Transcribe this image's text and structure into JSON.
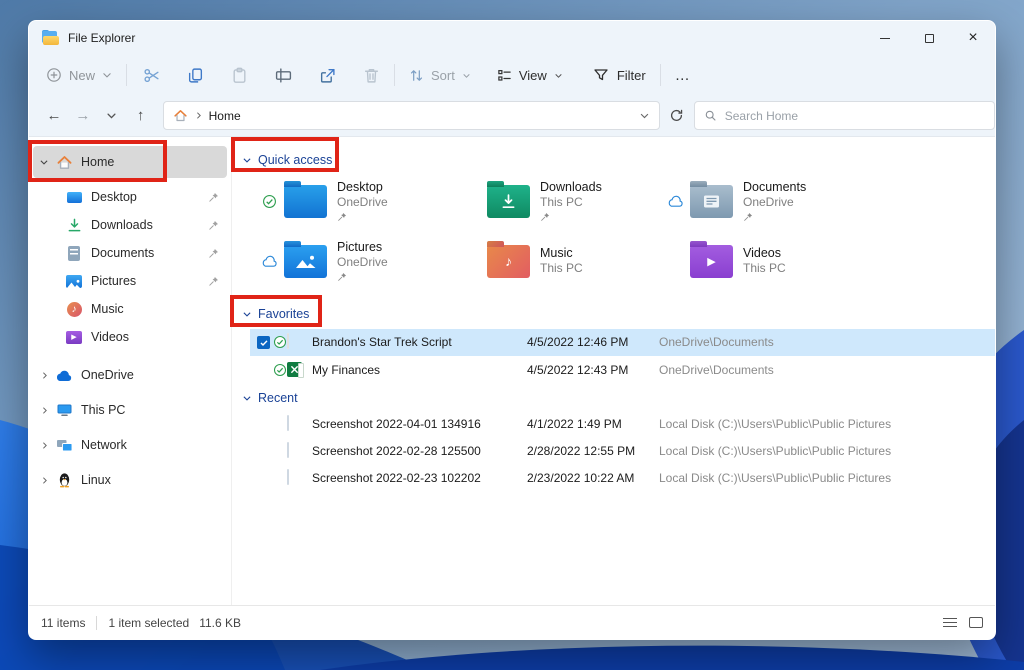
{
  "window": {
    "title": "File Explorer"
  },
  "toolbar": {
    "new": "New",
    "sort": "Sort",
    "view": "View",
    "filter": "Filter",
    "more": "…"
  },
  "address_bar": {
    "location": "Home",
    "search_placeholder": "Search Home"
  },
  "sidebar": {
    "items": [
      {
        "label": "Home"
      },
      {
        "label": "Desktop"
      },
      {
        "label": "Downloads"
      },
      {
        "label": "Documents"
      },
      {
        "label": "Pictures"
      },
      {
        "label": "Music"
      },
      {
        "label": "Videos"
      },
      {
        "label": "OneDrive"
      },
      {
        "label": "This PC"
      },
      {
        "label": "Network"
      },
      {
        "label": "Linux"
      }
    ]
  },
  "quick_access": {
    "header": "Quick access",
    "tiles": [
      {
        "name": "Desktop",
        "location": "OneDrive",
        "pinned": true,
        "sync": "synced"
      },
      {
        "name": "Downloads",
        "location": "This PC",
        "pinned": true,
        "sync": "none"
      },
      {
        "name": "Documents",
        "location": "OneDrive",
        "pinned": true,
        "sync": "cloud"
      },
      {
        "name": "Pictures",
        "location": "OneDrive",
        "pinned": true,
        "sync": "cloud"
      },
      {
        "name": "Music",
        "location": "This PC",
        "pinned": false,
        "sync": "none"
      },
      {
        "name": "Videos",
        "location": "This PC",
        "pinned": false,
        "sync": "none"
      }
    ]
  },
  "favorites": {
    "header": "Favorites",
    "files": [
      {
        "name": "Brandon's Star Trek Script",
        "date": "4/5/2022 12:46 PM",
        "location": "OneDrive\\Documents",
        "selected": true
      },
      {
        "name": "My Finances",
        "date": "4/5/2022 12:43 PM",
        "location": "OneDrive\\Documents",
        "selected": false
      }
    ]
  },
  "recent": {
    "header": "Recent",
    "files": [
      {
        "name": "Screenshot 2022-04-01 134916",
        "date": "4/1/2022 1:49 PM",
        "location": "Local Disk (C:)\\Users\\Public\\Public Pictures"
      },
      {
        "name": "Screenshot 2022-02-28 125500",
        "date": "2/28/2022 12:55 PM",
        "location": "Local Disk (C:)\\Users\\Public\\Public Pictures"
      },
      {
        "name": "Screenshot 2022-02-23 102202",
        "date": "2/23/2022 10:22 AM",
        "location": "Local Disk (C:)\\Users\\Public\\Public Pictures"
      }
    ]
  },
  "status_bar": {
    "items": "11 items",
    "selected": "1 item selected",
    "size": "11.6 KB"
  },
  "icons": {
    "back_glyph": "←",
    "forward_glyph": "→",
    "up_glyph": "↑",
    "close_glyph": "×",
    "music_glyph": "♪",
    "play_glyph": "▶"
  },
  "colors": {
    "annotation_red": "#e02417",
    "selection_blue": "#cfe8fc",
    "header_blue": "#1a4296"
  }
}
